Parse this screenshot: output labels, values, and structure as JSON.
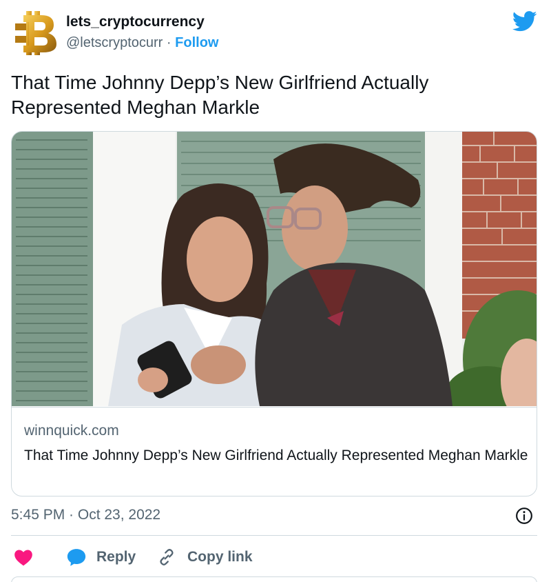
{
  "author": {
    "display_name": "lets_cryptocurrency",
    "handle": "@letscryptocurr",
    "separator": "·",
    "follow_label": "Follow",
    "avatar_icon": "bitcoin-gold-logo"
  },
  "tweet": {
    "text": "That Time Johnny Depp’s New Girlfriend Actually Represented Meghan Markle"
  },
  "card": {
    "domain": "winnquick.com",
    "title": "That Time Johnny Depp’s New Girlfriend Actually Represented Meghan Markle",
    "image_description_icon": "photo-two-people-looking-at-phone"
  },
  "meta": {
    "timestamp": "5:45 PM · Oct 23, 2022"
  },
  "actions": {
    "reply_label": "Reply",
    "copy_link_label": "Copy link"
  },
  "colors": {
    "accent": "#1d9bf0",
    "like": "#f91880",
    "secondary_text": "#536471",
    "border": "#cfd9de"
  }
}
